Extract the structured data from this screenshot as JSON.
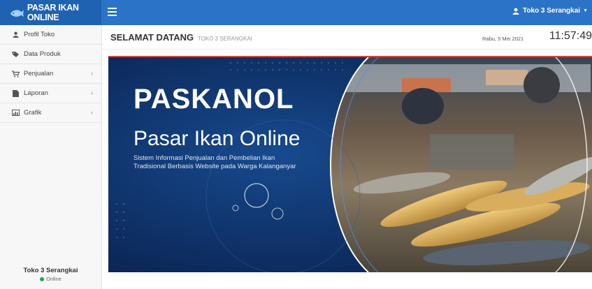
{
  "brand": {
    "name": "PASAR IKAN ONLINE",
    "icon": "fish-logo-icon"
  },
  "header": {
    "user_label": "Toko 3 Serangkai"
  },
  "sidebar": {
    "items": [
      {
        "label": "Profil Toko",
        "icon": "user-icon"
      },
      {
        "label": "Data Produk",
        "icon": "tag-icon"
      },
      {
        "label": "Penjualan",
        "icon": "cart-icon",
        "chevron": "‹"
      },
      {
        "label": "Laporan",
        "icon": "file-icon",
        "chevron": "‹"
      },
      {
        "label": "Grafik",
        "icon": "chart-icon",
        "chevron": "‹"
      }
    ],
    "footer": {
      "user_name": "Toko 3 Serangkai",
      "status": "Online"
    }
  },
  "content": {
    "title": "SELAMAT DATANG",
    "subtitle": "TOKO 3 SERANGKAI",
    "date": "Rabu, 5 Mei 2021",
    "time": "11:57:49"
  },
  "banner": {
    "title": "PASKANOL",
    "subtitle": "Pasar Ikan Online",
    "description_line1": "Sistem Informasi Penjualan dan Pembelian Ikan",
    "description_line2": "Tradisional Berbasis Website pada Warga Kalanganyar"
  },
  "colors": {
    "topbar": "#2b73c6",
    "brand_bg": "#1f62b2",
    "banner_bg": "#0d2a5c",
    "online": "#2aa34a"
  }
}
